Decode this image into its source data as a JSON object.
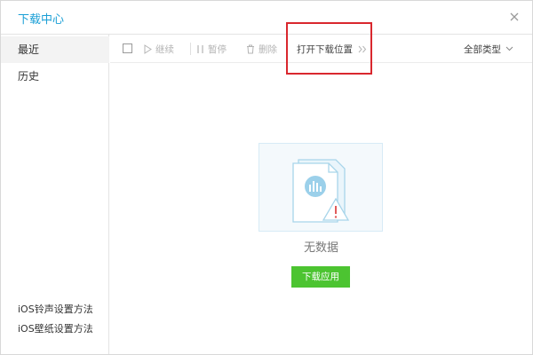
{
  "window": {
    "title": "下载中心"
  },
  "icons": {
    "close": "close-icon",
    "play": "play-icon",
    "pause": "pause-icon",
    "trash": "trash-icon",
    "chevron": "chevron-down-icon",
    "arrows": "double-chevron-right-icon"
  },
  "sidebar": {
    "items": [
      {
        "label": "最近",
        "active": true
      },
      {
        "label": "历史",
        "active": false
      }
    ],
    "links": [
      {
        "label": "iOS铃声设置方法"
      },
      {
        "label": "iOS壁纸设置方法"
      }
    ]
  },
  "toolbar": {
    "resume_label": "继续",
    "pause_label": "暂停",
    "delete_label": "删除",
    "open_location_label": "打开下载位置",
    "filter_label": "全部类型"
  },
  "main": {
    "empty_text": "无数据",
    "download_app_label": "下载应用"
  },
  "colors": {
    "title": "#1a9fd6",
    "highlight": "#d9272e",
    "button": "#4cc431",
    "illustration": "#a8d5ea"
  }
}
